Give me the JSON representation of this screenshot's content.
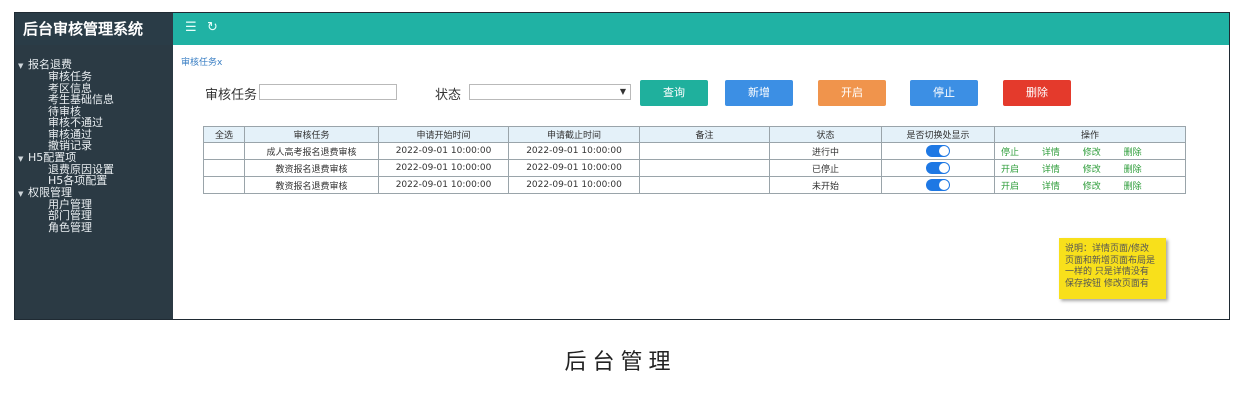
{
  "app": {
    "title": "后台审核管理系统"
  },
  "topbar": {
    "menu_icon": "☰",
    "refresh_icon": "↻"
  },
  "sidebar": {
    "groups": [
      {
        "label": "报名退费",
        "items": [
          "审核任务",
          "考区信息",
          "考生基础信息",
          "待审核",
          "审核不通过",
          "审核通过",
          "撤销记录"
        ]
      },
      {
        "label": "H5配置项",
        "items": [
          "退费原因设置",
          "H5各项配置"
        ]
      },
      {
        "label": "权限管理",
        "items": [
          "用户管理",
          "部门管理",
          "角色管理"
        ]
      }
    ]
  },
  "breadcrumb": {
    "tab": "审核任务x"
  },
  "filter": {
    "task_label": "审核任务",
    "task_value": "",
    "status_label": "状态",
    "status_value": ""
  },
  "buttons": {
    "query": "查询",
    "add": "新增",
    "start": "开启",
    "stop": "停止",
    "delete": "删除"
  },
  "colors": {
    "topbar": "#20b2a4",
    "sidebar": "#2b3a44",
    "query": "#1fb09d",
    "add": "#3c8fe4",
    "start": "#f0944c",
    "stop": "#3c8fe4",
    "delete": "#e43a2c",
    "op_link": "#2e9d3a",
    "toggle_on": "#1e78e4"
  },
  "table": {
    "headers": [
      "全选",
      "审核任务",
      "申请开始时间",
      "申请截止时间",
      "备注",
      "状态",
      "是否切换处显示",
      "操作"
    ],
    "rows": [
      {
        "name": "成人高考报名退费审核",
        "start": "2022-09-01 10:00:00",
        "end": "2022-09-01 10:00:00",
        "remark": "",
        "status": "进行中",
        "toggle_on": true,
        "ops": [
          "停止",
          "详情",
          "修改",
          "删除"
        ]
      },
      {
        "name": "教资报名退费审核",
        "start": "2022-09-01 10:00:00",
        "end": "2022-09-01 10:00:00",
        "remark": "",
        "status": "已停止",
        "toggle_on": true,
        "ops": [
          "开启",
          "详情",
          "修改",
          "删除"
        ]
      },
      {
        "name": "教资报名退费审核",
        "start": "2022-09-01 10:00:00",
        "end": "2022-09-01 10:00:00",
        "remark": "",
        "status": "未开始",
        "toggle_on": true,
        "ops": [
          "开启",
          "详情",
          "修改",
          "删除"
        ]
      }
    ]
  },
  "note": {
    "lines": [
      "说明：详情页面/修改",
      "页面和新增页面布局是",
      "一样的 只是详情没有",
      "保存按钮 修改页面有"
    ]
  },
  "caption": "后台管理"
}
